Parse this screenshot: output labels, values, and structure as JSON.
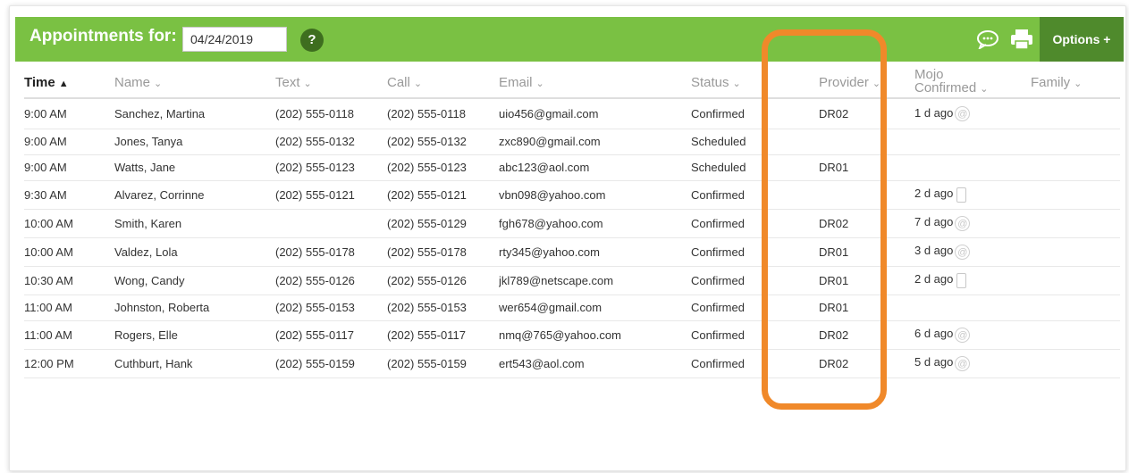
{
  "header": {
    "title": "Appointments for:",
    "date_value": "04/24/2019",
    "help_label": "?",
    "options_label": "Options +",
    "bar_color": "#7ac143",
    "highlight_color": "#f0892a"
  },
  "columns": [
    {
      "label": "Time",
      "sorted": true,
      "chevron": "▲"
    },
    {
      "label": "Name",
      "chevron": "⌄"
    },
    {
      "label": "Text",
      "chevron": "⌄"
    },
    {
      "label": "Call",
      "chevron": "⌄"
    },
    {
      "label": "Email",
      "chevron": "⌄"
    },
    {
      "label": "Status",
      "chevron": "⌄"
    },
    {
      "label": "Provider",
      "chevron": "⌄"
    },
    {
      "label_line1": "Mojo",
      "label_line2": "Confirmed",
      "chevron": "⌄"
    },
    {
      "label": "Family",
      "chevron": "⌄"
    }
  ],
  "rows": [
    {
      "time": "9:00 AM",
      "name": "Sanchez, Martina",
      "text": "(202) 555-0118",
      "call": "(202) 555-0118",
      "email": "uio456@gmail.com",
      "status": "Confirmed",
      "provider": "DR02",
      "mojo": "1 d ago",
      "mojo_icon": "at-icon"
    },
    {
      "time": "9:00 AM",
      "name": "Jones, Tanya",
      "text": "(202) 555-0132",
      "call": "(202) 555-0132",
      "email": "zxc890@gmail.com",
      "status": "Scheduled",
      "provider": "",
      "mojo": "",
      "mojo_icon": ""
    },
    {
      "time": "9:00 AM",
      "name": "Watts, Jane",
      "text": "(202) 555-0123",
      "call": "(202) 555-0123",
      "email": "abc123@aol.com",
      "status": "Scheduled",
      "provider": "DR01",
      "mojo": "",
      "mojo_icon": ""
    },
    {
      "time": "9:30 AM",
      "name": "Alvarez, Corrinne",
      "text": "(202) 555-0121",
      "call": "(202) 555-0121",
      "email": "vbn098@yahoo.com",
      "status": "Confirmed",
      "provider": "",
      "mojo": "2 d ago",
      "mojo_icon": "phone-icon"
    },
    {
      "time": "10:00 AM",
      "name": "Smith, Karen",
      "text": "",
      "call": "(202) 555-0129",
      "email": "fgh678@yahoo.com",
      "status": "Confirmed",
      "provider": "DR02",
      "mojo": "7 d ago",
      "mojo_icon": "at-icon"
    },
    {
      "time": "10:00 AM",
      "name": "Valdez, Lola",
      "text": "(202) 555-0178",
      "call": "(202) 555-0178",
      "email": "rty345@yahoo.com",
      "status": "Confirmed",
      "provider": "DR01",
      "mojo": "3 d ago",
      "mojo_icon": "at-icon"
    },
    {
      "time": "10:30 AM",
      "name": "Wong, Candy",
      "text": "(202) 555-0126",
      "call": "(202) 555-0126",
      "email": "jkl789@netscape.com",
      "status": "Confirmed",
      "provider": "DR01",
      "mojo": "2 d ago",
      "mojo_icon": "phone-icon"
    },
    {
      "time": "11:00 AM",
      "name": "Johnston, Roberta",
      "text": "(202) 555-0153",
      "call": "(202) 555-0153",
      "email": "wer654@gmail.com",
      "status": "Confirmed",
      "provider": "DR01",
      "mojo": "",
      "mojo_icon": ""
    },
    {
      "time": "11:00 AM",
      "name": "Rogers, Elle",
      "text": "(202) 555-0117",
      "call": "(202) 555-0117",
      "email": "nmq@765@yahoo.com",
      "status": "Confirmed",
      "provider": "DR02",
      "mojo": "6 d ago",
      "mojo_icon": "at-icon"
    },
    {
      "time": "12:00 PM",
      "name": "Cuthburt, Hank",
      "text": "(202) 555-0159",
      "call": "(202) 555-0159",
      "email": "ert543@aol.com",
      "status": "Confirmed",
      "provider": "DR02",
      "mojo": "5 d ago",
      "mojo_icon": "at-icon"
    }
  ]
}
